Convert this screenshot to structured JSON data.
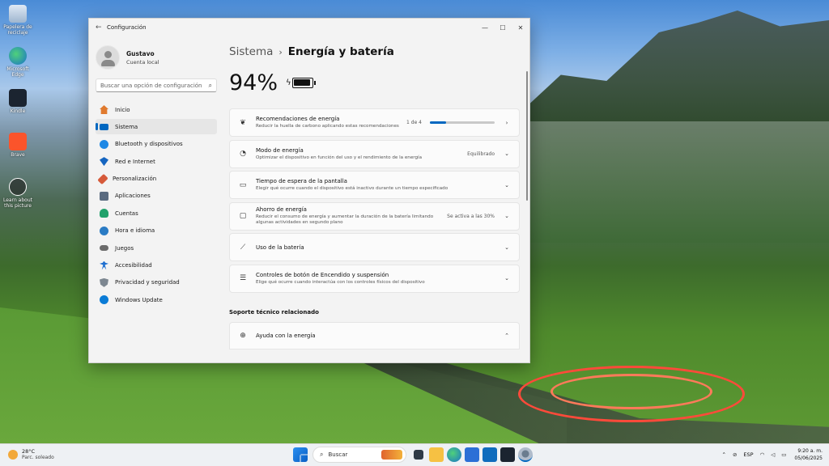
{
  "desktop": {
    "icons": [
      {
        "label": "Papelera de reciclaje",
        "icon": "recycle-bin-icon"
      },
      {
        "label": "Microsoft Edge",
        "icon": "edge-icon"
      },
      {
        "label": "Kindle",
        "icon": "kindle-icon"
      },
      {
        "label": "Brave",
        "icon": "brave-icon"
      },
      {
        "label": "Learn about this picture",
        "icon": "learn-icon"
      }
    ]
  },
  "window": {
    "title": "Configuración",
    "minimize": "—",
    "maximize": "☐",
    "close": "✕"
  },
  "user": {
    "name": "Gustavo",
    "type": "Cuenta local"
  },
  "search": {
    "placeholder": "Buscar una opción de configuración"
  },
  "nav": [
    {
      "label": "Inicio",
      "icon": "home-icon",
      "color": "#e07a2e"
    },
    {
      "label": "Sistema",
      "icon": "system-icon",
      "color": "#0067c0",
      "active": true
    },
    {
      "label": "Bluetooth y dispositivos",
      "icon": "bluetooth-icon",
      "color": "#1e88e5"
    },
    {
      "label": "Red e Internet",
      "icon": "wifi-icon",
      "color": "#1565c0"
    },
    {
      "label": "Personalización",
      "icon": "brush-icon",
      "color": "#d65a3a"
    },
    {
      "label": "Aplicaciones",
      "icon": "apps-icon",
      "color": "#5a6b80"
    },
    {
      "label": "Cuentas",
      "icon": "accounts-icon",
      "color": "#21a16b"
    },
    {
      "label": "Hora e idioma",
      "icon": "globe-clock-icon",
      "color": "#2a7bc4"
    },
    {
      "label": "Juegos",
      "icon": "gamepad-icon",
      "color": "#6b6b6b"
    },
    {
      "label": "Accesibilidad",
      "icon": "accessibility-icon",
      "color": "#1e6fd0"
    },
    {
      "label": "Privacidad y seguridad",
      "icon": "shield-icon",
      "color": "#7d8791"
    },
    {
      "label": "Windows Update",
      "icon": "update-icon",
      "color": "#0a7bd6"
    }
  ],
  "breadcrumb": {
    "parent": "Sistema",
    "separator": "›",
    "current": "Energía y batería"
  },
  "battery": {
    "percent": "94%",
    "level": 0.94
  },
  "cards": [
    {
      "title": "Recomendaciones de energía",
      "subtitle": "Reducir la huella de carbono aplicando estas recomendaciones",
      "value": "1 de 4",
      "progress": 0.25,
      "chevron": "›",
      "icon": "leaf-icon"
    },
    {
      "title": "Modo de energía",
      "subtitle": "Optimizar el dispositivo en función del uso y el rendimiento de la energía",
      "value": "Equilibrado",
      "chevron": "⌄",
      "icon": "gauge-icon"
    },
    {
      "title": "Tiempo de espera de la pantalla",
      "subtitle": "Elegir qué ocurre cuando el dispositivo está inactivo durante un tiempo especificado",
      "value": "",
      "chevron": "⌄",
      "icon": "screen-timeout-icon"
    },
    {
      "title": "Ahorro de energía",
      "subtitle": "Reducir el consumo de energía y aumentar la duración de la batería limitando algunas actividades en segundo plano",
      "value": "Se activa a las 30%",
      "chevron": "⌄",
      "icon": "battery-saver-icon"
    },
    {
      "title": "Uso de la batería",
      "subtitle": "",
      "value": "",
      "chevron": "⌄",
      "icon": "chart-icon"
    },
    {
      "title": "Controles de botón de Encendido y suspensión",
      "subtitle": "Elige qué ocurre cuando interactúa con los controles físicos del dispositivo",
      "value": "",
      "chevron": "⌄",
      "icon": "list-icon"
    }
  ],
  "support": {
    "title": "Soporte técnico relacionado",
    "item": {
      "title": "Ayuda con la energía",
      "chevron": "⌃",
      "icon": "globe-icon"
    }
  },
  "taskbar": {
    "weather": {
      "temp": "28°C",
      "desc": "Parc. soleado"
    },
    "search": "Buscar",
    "tray": {
      "lang": "ESP",
      "time": "9:20 a. m.",
      "date": "05/06/2025"
    }
  }
}
